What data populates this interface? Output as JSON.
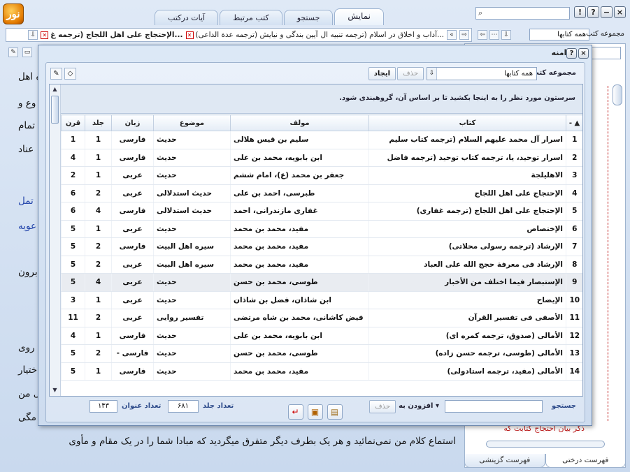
{
  "window": {
    "logo_text": "نور",
    "tabs": [
      "نمایش",
      "جستجو",
      "کتب مرتبط",
      "آیات درکتب"
    ],
    "win_buttons": [
      "×",
      "−",
      "?",
      "!"
    ]
  },
  "docbar": {
    "tabs": [
      {
        "label": "الإحتجاج علی اهل اللجاج (ترجمه غ...",
        "active": true,
        "closable": true
      },
      {
        "label": "آیین بندگی و نیایش (ترجمه عدة الداعی)",
        "active": false,
        "closable": true
      },
      {
        "label": "آداب و اخلاق در اسلام (ترجمه تنبیه ال...",
        "active": false,
        "closable": false
      }
    ],
    "collection_label": "مجموعه کتب",
    "collection_value": "همه کتابها",
    "nav_buttons": [
      "⇦",
      "⇨",
      "⋯",
      "⇩"
    ]
  },
  "background_doc": {
    "lines": [
      "ه اهل",
      "وع و",
      "تمام",
      "عناد",
      "تمل",
      "عویه",
      "برون",
      "روی",
      "ختیار",
      "ل من",
      "مگی"
    ],
    "bottom_line": "استماع کلام من نمی‌نمائید و هر یک بطرف دیگر متفرق میگردید که مبادا شما را در یک مقام و مأوی"
  },
  "right_panel": {
    "tree_item": "ذکر بیان احتجاج کتابت که",
    "bottom_tabs": [
      "فهرست درختی",
      "فهرست گزینشی"
    ]
  },
  "dialog": {
    "title": "دامنه",
    "toolbar": {
      "collection_label": "مجموعه کتب",
      "collection_value": "همه کتابها",
      "delete_label": "حذف",
      "create_label": "ایجاد"
    },
    "group_hint": "سرستون مورد نظر را به اینجا بکشید تا بر اساس آن، گروهبندی شود.",
    "columns": [
      "",
      "کتاب",
      "مولف",
      "موضوع",
      "زبان",
      "جلد",
      "قرن"
    ],
    "rows": [
      {
        "n": "1",
        "title": "اسرار آل محمد علیهم السلام (ترجمه کتاب سلیم",
        "author": "سلیم بن قیس هلالی",
        "subject": "حدیث",
        "lang": "فارسی",
        "vol": "1",
        "century": "1"
      },
      {
        "n": "2",
        "title": "اسرار توحید، یا، ترجمه کتاب توحید (ترجمه فاضل",
        "author": "ابن بابویه، محمد بن علی",
        "subject": "حدیث",
        "lang": "فارسی",
        "vol": "1",
        "century": "4"
      },
      {
        "n": "3",
        "title": "الاهلیلجة",
        "author": "جعفر بن محمد (ع)، امام ششم",
        "subject": "حدیث",
        "lang": "عربی",
        "vol": "1",
        "century": "2"
      },
      {
        "n": "4",
        "title": "الإحتجاج علی اهل اللجاج",
        "author": "طبرسی، احمد بن علی",
        "subject": "حدیث استدلالی",
        "lang": "عربی",
        "vol": "2",
        "century": "6"
      },
      {
        "n": "5",
        "title": "الإحتجاج علی اهل اللجاج (ترجمه غفاری)",
        "author": "غفاری مازندرانی، احمد",
        "subject": "حدیث استدلالی",
        "lang": "فارسی",
        "vol": "4",
        "century": "6"
      },
      {
        "n": "6",
        "title": "الإختصاص",
        "author": "مفید، محمد بن محمد",
        "subject": "حدیث",
        "lang": "عربی",
        "vol": "1",
        "century": "5"
      },
      {
        "n": "7",
        "title": "الإرشاد (ترجمه رسولی محلاتی)",
        "author": "مفید، محمد بن محمد",
        "subject": "سیره اهل البیت",
        "lang": "فارسی",
        "vol": "2",
        "century": "5"
      },
      {
        "n": "8",
        "title": "الإرشاد فی معرفة حجج الله علی العباد",
        "author": "مفید، محمد بن محمد",
        "subject": "سیره اهل البیت",
        "lang": "عربی",
        "vol": "2",
        "century": "5"
      },
      {
        "n": "9",
        "title": "الإستبصار فیما اختلف من الأخبار",
        "author": "طوسی، محمد بن حسن",
        "subject": "حدیث",
        "lang": "عربی",
        "vol": "4",
        "century": "5",
        "selected": true
      },
      {
        "n": "10",
        "title": "الإیضاح",
        "author": "ابن شاذان، فضل بن شاذان",
        "subject": "حدیث",
        "lang": "عربی",
        "vol": "1",
        "century": "3"
      },
      {
        "n": "11",
        "title": "الأصفی فی تفسیر القرآن",
        "author": "فیض کاشانی، محمد بن شاه مرتضی",
        "subject": "تفسیر روایی",
        "lang": "عربی",
        "vol": "2",
        "century": "11"
      },
      {
        "n": "12",
        "title": "الأمالی (صدوق، ترجمه کمره ای)",
        "author": "ابن بابویه، محمد بن علی",
        "subject": "حدیث",
        "lang": "فارسی",
        "vol": "1",
        "century": "4"
      },
      {
        "n": "13",
        "title": "الأمالی (طوسی، ترجمه حسن زاده)",
        "author": "طوسی، محمد بن حسن",
        "subject": "حدیث",
        "lang": "فارسی -",
        "vol": "2",
        "century": "5"
      },
      {
        "n": "14",
        "title": "الأمالی (مفید، ترجمه استادولی)",
        "author": "مفید، محمد بن محمد",
        "subject": "حدیث",
        "lang": "فارسی",
        "vol": "1",
        "century": "5"
      }
    ],
    "bottom": {
      "search_label": "جستجو",
      "add_to_label": "افزودن به",
      "delete_label": "حذف",
      "volume_count_label": "تعداد جلد",
      "volume_count": "۶۸۱",
      "title_count_label": "تعداد عنوان",
      "title_count": "۱۴۳"
    }
  }
}
